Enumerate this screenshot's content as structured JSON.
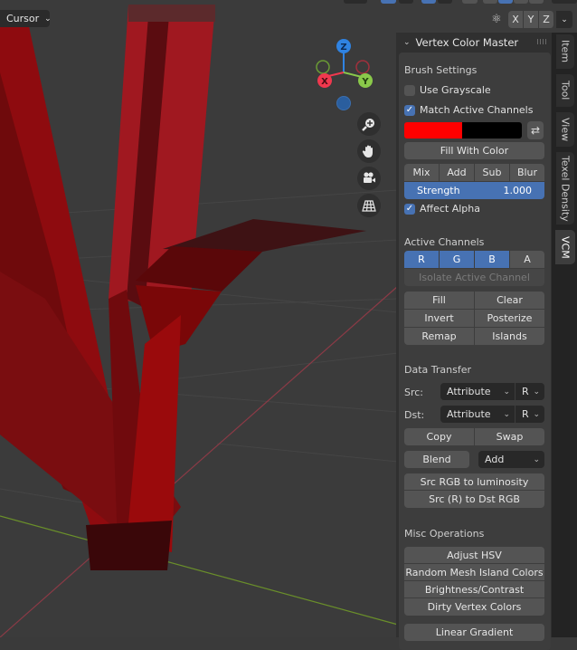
{
  "viewport": {
    "transform_pivot": {
      "label": "Cursor",
      "icon": "chevron-down-icon"
    },
    "mirror": {
      "icon": "butterfly-mirror-icon",
      "axes": [
        "X",
        "Y",
        "Z"
      ]
    },
    "gizmo": {
      "axes": [
        "Z",
        "X",
        "Y"
      ],
      "colors": {
        "x": "#f0384e",
        "y": "#8ac94a",
        "z": "#2f83e3"
      }
    },
    "nav_buttons": [
      {
        "name": "zoom",
        "icon": "zoom-icon"
      },
      {
        "name": "pan",
        "icon": "hand-icon"
      },
      {
        "name": "camera",
        "icon": "camera-icon"
      },
      {
        "name": "ortho",
        "icon": "grid-icon"
      }
    ]
  },
  "panel": {
    "title": "Vertex Color Master",
    "brush_settings": {
      "heading": "Brush Settings",
      "use_grayscale": {
        "label": "Use Grayscale",
        "checked": false
      },
      "match_active_channels": {
        "label": "Match Active Channels",
        "checked": true
      },
      "color_primary": "#ff0000",
      "color_secondary": "#000000",
      "fill_with_color": "Fill With Color",
      "blend_modes": [
        "Mix",
        "Add",
        "Sub",
        "Blur"
      ],
      "strength": {
        "label": "Strength",
        "value": "1.000"
      },
      "affect_alpha": {
        "label": "Affect Alpha",
        "checked": true
      }
    },
    "active_channels": {
      "heading": "Active Channels",
      "channels": [
        {
          "label": "R",
          "active": true
        },
        {
          "label": "G",
          "active": true
        },
        {
          "label": "B",
          "active": true
        },
        {
          "label": "A",
          "active": false
        }
      ],
      "isolate": "Isolate Active Channel",
      "ops": [
        "Fill",
        "Clear",
        "Invert",
        "Posterize",
        "Remap",
        "Islands"
      ]
    },
    "data_transfer": {
      "heading": "Data Transfer",
      "src_label": "Src:",
      "src_type": "Attribute",
      "src_channel": "R",
      "dst_label": "Dst:",
      "dst_type": "Attribute",
      "dst_channel": "R",
      "copy": "Copy",
      "swap": "Swap",
      "blend": "Blend",
      "blend_mode": "Add",
      "rgb_to_lum": "Src RGB to luminosity",
      "r_to_rgb": "Src (R) to Dst RGB"
    },
    "misc": {
      "heading": "Misc Operations",
      "ops": [
        "Adjust HSV",
        "Random Mesh Island Colors",
        "Brightness/Contrast",
        "Dirty Vertex Colors"
      ],
      "linear_gradient": "Linear Gradient"
    }
  },
  "tabs": [
    {
      "label": "Item",
      "active": false
    },
    {
      "label": "Tool",
      "active": false
    },
    {
      "label": "View",
      "active": false
    },
    {
      "label": "Texel Density",
      "active": false
    },
    {
      "label": "VCM",
      "active": true
    }
  ]
}
